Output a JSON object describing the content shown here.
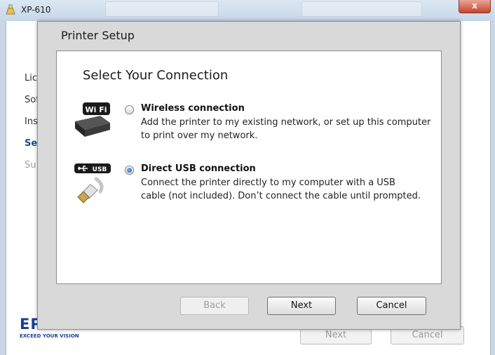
{
  "background_window": {
    "title": "XP-610",
    "close_symbol": "x",
    "nav_items": [
      {
        "label": "Lic",
        "state": "normal"
      },
      {
        "label": "Sof",
        "state": "normal"
      },
      {
        "label": "Ins",
        "state": "normal"
      },
      {
        "label": "Set",
        "state": "active"
      },
      {
        "label": "Su",
        "state": "dim"
      }
    ],
    "logo": {
      "mark": "EP",
      "tagline": "EXCEED YOUR VISION"
    },
    "next_label": "Next",
    "cancel_label": "Cancel"
  },
  "dialog": {
    "title": "Printer Setup",
    "heading": "Select Your Connection",
    "options": [
      {
        "title": "Wireless connection",
        "desc_lines": [
          "Add the printer to my existing network, or set up this computer",
          "to print over my network."
        ],
        "selected": false,
        "icon": "wifi-printer-icon",
        "badge": "Wi Fi"
      },
      {
        "title": "Direct USB connection",
        "desc_lines": [
          "Connect the printer directly to my computer with a USB",
          "cable (not included). Don’t connect the cable until prompted."
        ],
        "selected": true,
        "icon": "usb-cable-icon",
        "badge": "USB"
      }
    ],
    "buttons": {
      "back": "Back",
      "next": "Next",
      "cancel": "Cancel"
    }
  },
  "colors": {
    "accent": "#1d5ab2",
    "brand": "#1b3f93",
    "dialog_bg": "#d9d9d9"
  }
}
